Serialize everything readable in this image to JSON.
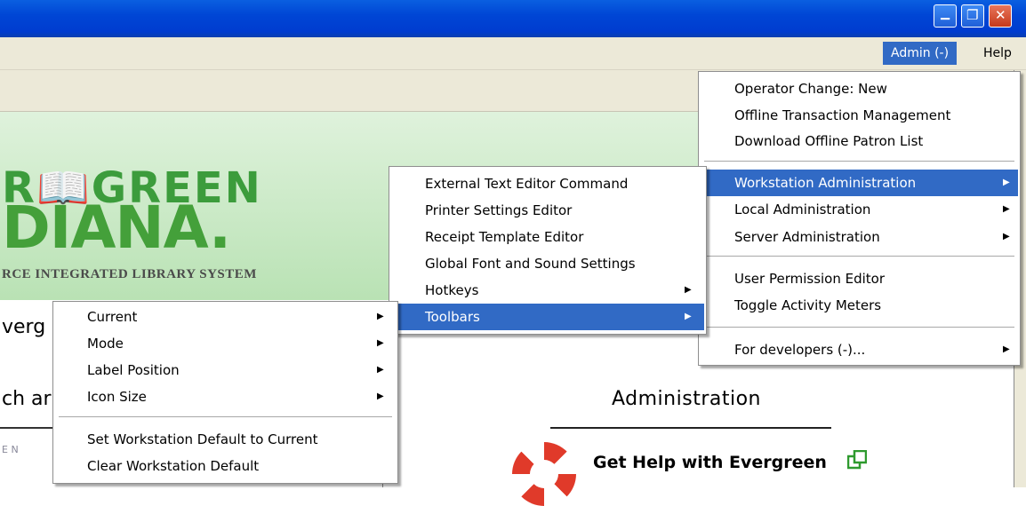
{
  "window": {
    "minimize_glyph": "▁",
    "maximize_glyph": "❐",
    "close_glyph": "✕"
  },
  "menubar": {
    "admin": "Admin (-)",
    "help": "Help"
  },
  "page": {
    "logo_line1": "R📖GREEN",
    "logo_line2": "DIANA.",
    "logo_line3": "RCE INTEGRATED LIBRARY SYSTEM",
    "welcome_fragment": "verg",
    "search_fragment": "ch ar",
    "left_col_fragment": "E N",
    "admin_title": "Administration",
    "help_link": "Get Help with Evergreen"
  },
  "admin_menu": {
    "items": [
      {
        "label": "Operator Change: New"
      },
      {
        "label": "Offline Transaction Management"
      },
      {
        "label": "Download Offline Patron List"
      },
      {
        "label": "Workstation Administration",
        "submenu": true,
        "selected": true
      },
      {
        "label": "Local Administration",
        "submenu": true
      },
      {
        "label": "Server Administration",
        "submenu": true
      },
      {
        "label": "User Permission Editor"
      },
      {
        "label": "Toggle Activity Meters"
      },
      {
        "label": "For developers (-)...",
        "submenu": true
      }
    ]
  },
  "workstation_menu": {
    "items": [
      {
        "label": "External Text Editor Command"
      },
      {
        "label": "Printer Settings Editor"
      },
      {
        "label": "Receipt Template Editor"
      },
      {
        "label": "Global Font and Sound Settings"
      },
      {
        "label": "Hotkeys",
        "submenu": true
      },
      {
        "label": "Toolbars",
        "submenu": true,
        "selected": true
      }
    ]
  },
  "toolbars_menu": {
    "items": [
      {
        "label": "Current",
        "submenu": true
      },
      {
        "label": "Mode",
        "submenu": true
      },
      {
        "label": "Label Position",
        "submenu": true
      },
      {
        "label": "Icon Size",
        "submenu": true
      },
      {
        "label": "Set Workstation Default to Current"
      },
      {
        "label": "Clear Workstation Default"
      }
    ]
  },
  "colors": {
    "titlebar": "#0046d5",
    "menu_highlight": "#316ac5",
    "logo_green": "#44a03a"
  },
  "icons": {
    "submenu_arrow": "▶",
    "help_external": "external-link-icon"
  }
}
